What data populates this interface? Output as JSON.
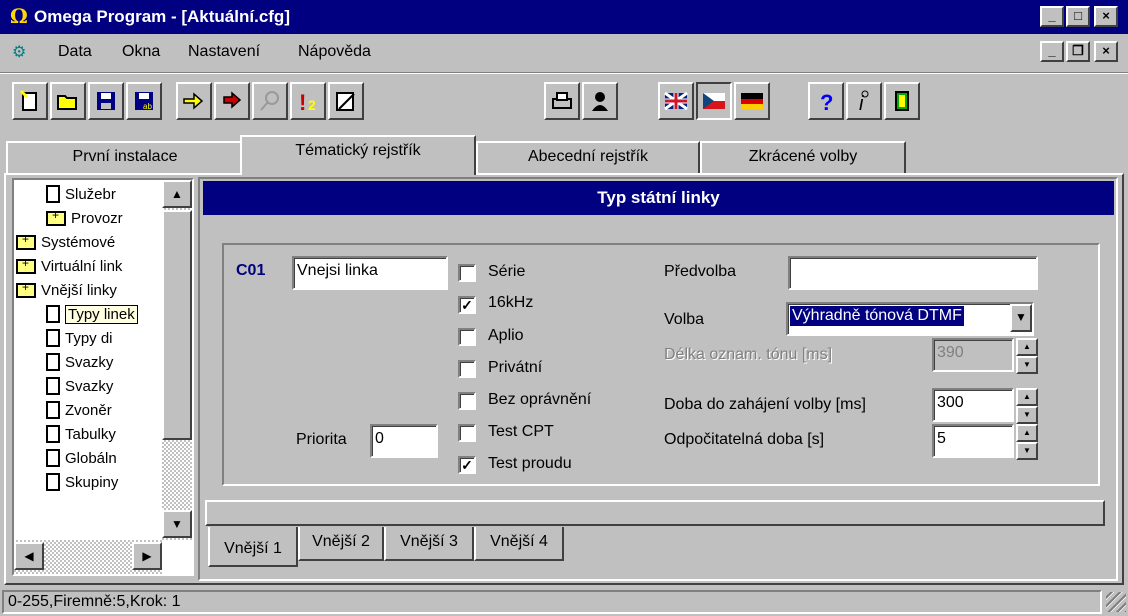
{
  "window": {
    "title": "Omega Program - [Aktuální.cfg]"
  },
  "menu": [
    "Data",
    "Okna",
    "Nastavení",
    "Nápověda"
  ],
  "toolbar_icons": [
    "new-icon",
    "open-icon",
    "save-icon",
    "save-as-icon",
    "import-icon",
    "export-icon",
    "search-icon",
    "warning-icon",
    "edit-icon",
    "print-icon",
    "user-icon",
    "uk-flag-icon",
    "cz-flag-icon",
    "de-flag-icon",
    "help-icon",
    "info-icon",
    "exit-icon"
  ],
  "tabs": [
    "První instalace",
    "Tématický rejstřík",
    "Abecední rejstřík",
    "Zkrácené volby"
  ],
  "active_tab": "Tématický rejstřík",
  "tree": [
    {
      "label": "Služebr",
      "icon": "file-icon",
      "indent": 1
    },
    {
      "label": "Provozr",
      "icon": "folder-icon",
      "indent": 1
    },
    {
      "label": "Systémové",
      "icon": "folder-icon",
      "indent": 0
    },
    {
      "label": "Virtuální link",
      "icon": "folder-icon",
      "indent": 0
    },
    {
      "label": "Vnější linky",
      "icon": "folder-open-icon",
      "indent": 0
    },
    {
      "label": "Typy linek",
      "icon": "file-icon",
      "indent": 1,
      "selected": true
    },
    {
      "label": "Typy di",
      "icon": "file-icon",
      "indent": 1
    },
    {
      "label": "Svazky",
      "icon": "file-icon",
      "indent": 1
    },
    {
      "label": "Svazky",
      "icon": "file-icon",
      "indent": 1
    },
    {
      "label": "Zvoněr",
      "icon": "file-icon",
      "indent": 1
    },
    {
      "label": "Tabulky",
      "icon": "file-icon",
      "indent": 1
    },
    {
      "label": "Globáln",
      "icon": "file-icon",
      "indent": 1
    },
    {
      "label": "Skupiny",
      "icon": "file-icon",
      "indent": 1
    }
  ],
  "panel": {
    "header": "Typ státní linky",
    "co_label": "C01",
    "co_value": "Vnejsi linka",
    "priority_label": "Priorita",
    "priority_value": "0",
    "checkboxes": [
      {
        "label": "Série",
        "checked": false
      },
      {
        "label": "16kHz",
        "checked": true
      },
      {
        "label": "Aplio",
        "checked": false
      },
      {
        "label": "Privátní",
        "checked": false
      },
      {
        "label": "Bez oprávnění",
        "checked": false
      },
      {
        "label": "Test CPT",
        "checked": false
      },
      {
        "label": "Test proudu",
        "checked": true
      }
    ],
    "predvolba_label": "Předvolba",
    "predvolba_value": "",
    "volba_label": "Volba",
    "volba_value": "Výhradně tónová DTMF",
    "delka_label": "Délka oznam. tónu [ms]",
    "delka_value": "390",
    "doba_label": "Doba do zahájení volby [ms]",
    "doba_value": "300",
    "odpocitatelna_label": "Odpočitatelná doba [s]",
    "odpocitatelna_value": "5"
  },
  "bottom_tabs": [
    "Vnější 1",
    "Vnější 2",
    "Vnější 3",
    "Vnější 4"
  ],
  "status": "0-255,Firemně:5,Krok: 1"
}
